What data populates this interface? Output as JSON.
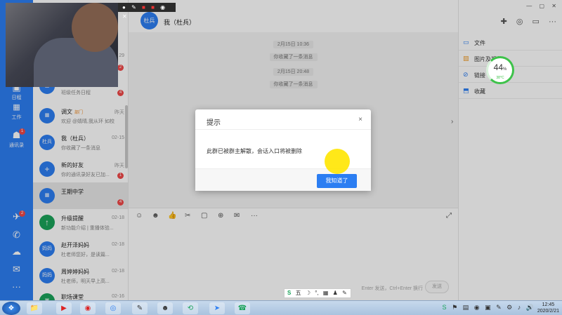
{
  "window": {
    "controls": [
      "—",
      "▢",
      "✕"
    ]
  },
  "sidebar": {
    "items": [
      {
        "label": "日程",
        "icon": "calendar-icon",
        "glyph": "▣"
      },
      {
        "label": "工作",
        "icon": "apps-grid-icon",
        "glyph": "⬛"
      },
      {
        "label": "通讯录",
        "icon": "contacts-icon",
        "glyph": "☗",
        "badge": "1"
      }
    ],
    "bottom": [
      {
        "icon": "help-icon",
        "glyph": "✈",
        "badge": "2"
      },
      {
        "icon": "phone-icon",
        "glyph": "✆"
      },
      {
        "icon": "cloud-icon",
        "glyph": "☁"
      },
      {
        "icon": "mail-icon",
        "glyph": "✉"
      },
      {
        "icon": "more-icon",
        "glyph": "···"
      }
    ]
  },
  "conversations": [
    {
      "avatar": "",
      "name": "",
      "preview": "班级任务日程",
      "time": "",
      "badge": "4"
    },
    {
      "avatar": "",
      "name": "调文",
      "tag": "部门",
      "preview": "欢迎 @婧晴,我从环 如校",
      "time": "昨天",
      "badge": ""
    },
    {
      "avatar": "杜兵",
      "name": "我（杜兵）",
      "preview": "你收藏了一条消息",
      "time": "02-15",
      "badge": ""
    },
    {
      "avatar": "+",
      "name": "新的好友",
      "preview": "你的通讯录好友已加...",
      "time": "昨天",
      "badge": "1"
    },
    {
      "avatar": "",
      "name": "王期中学",
      "preview": "",
      "time": "",
      "badge": "4"
    },
    {
      "avatar": "↑",
      "name": "升级提醒",
      "preview": "新功能介绍 | 重播体验...",
      "time": "02-18",
      "badge": ""
    },
    {
      "avatar": "妈妈",
      "name": "赵开泽妈妈",
      "preview": "杜老师您好，是读篇...",
      "time": "02-18",
      "badge": ""
    },
    {
      "avatar": "妈妈",
      "name": "周婷婷妈妈",
      "preview": "杜老师，明天早上高...",
      "time": "02-18",
      "badge": ""
    },
    {
      "avatar": "",
      "name": "职场课堂",
      "preview": "",
      "time": "02-16",
      "badge": ""
    }
  ],
  "conversations_top": {
    "time": "29",
    "badge": "2"
  },
  "chat": {
    "avatar": "杜兵",
    "title": "我（杜兵）",
    "messages": [
      {
        "text": "2月15日 10:36"
      },
      {
        "text": "你收藏了一条消息"
      },
      {
        "text": "2月15日 20:48"
      },
      {
        "text": "你收藏了一条消息"
      }
    ],
    "toolbar": [
      "☺",
      "☻",
      "👍",
      "✂",
      "▢",
      "⊕",
      "✉",
      "···"
    ],
    "send_hint": "Enter 发送，Ctrl+Enter 换行",
    "send_label": "发送"
  },
  "right_panel": {
    "items": [
      {
        "label": "文件",
        "glyph": "▭"
      },
      {
        "label": "图片及视频",
        "glyph": "▨"
      },
      {
        "label": "链接",
        "glyph": "⊘"
      },
      {
        "label": "收藏",
        "glyph": "⬒"
      }
    ],
    "top_icons": [
      "✚",
      "◎",
      "▭",
      "···"
    ]
  },
  "dialog": {
    "title": "提示",
    "close": "×",
    "message": "此群已被群主解散，会话入口将被删除",
    "button": "我知道了"
  },
  "gauge": {
    "percent": "44",
    "unit": "%",
    "temp": "38°C",
    "value": 0.44
  },
  "webcam_bar": {
    "icons": [
      "●",
      "✎",
      "■",
      "■",
      "◉",
      "✕"
    ]
  },
  "ime": {
    "items": [
      "S",
      "五",
      "☽",
      "°,",
      "▦",
      "♟",
      "✎"
    ]
  },
  "taskbar": {
    "apps": [
      "📁",
      "▶",
      "◉",
      "◎",
      "✎",
      "☻",
      "⟲",
      "➤",
      "☎"
    ],
    "tray": [
      "S",
      "⚑",
      "▤",
      "◉",
      "▣",
      "✎",
      "⚙",
      "♪",
      "🔊"
    ],
    "time": "12:45",
    "date": "2020/2/21"
  }
}
